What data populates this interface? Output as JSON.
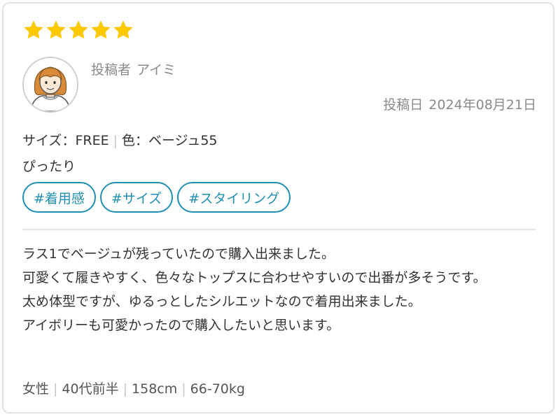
{
  "review": {
    "rating": 5,
    "rating_max": 5,
    "star_color": "#ffc700",
    "poster": {
      "label": "投稿者",
      "name": "アイミ"
    },
    "date": {
      "label": "投稿日",
      "value": "2024年08月21日"
    },
    "specs": {
      "size_label": "サイズ",
      "size_colon": "：",
      "size_value": "FREE",
      "separator": "|",
      "color_label": "色",
      "color_colon": "：",
      "color_value": "ベージュ55"
    },
    "fit": "ぴったり",
    "tags": [
      "#着用感",
      "#サイズ",
      "#スタイリング"
    ],
    "tag_color": "#1f8fb3",
    "body_lines": [
      "ラス1でベージュが残っていたので購入出来ました。",
      "可愛くて履きやすく、色々なトップスに合わせやすいので出番が多そうです。",
      "太め体型ですが、ゆるっとしたシルエットなので着用出来ました。",
      "アイボリーも可愛かったので購入したいと思います。"
    ],
    "profile": {
      "gender": "女性",
      "age": "40代前半",
      "height": "158cm",
      "weight": "66-70kg",
      "separator": "|"
    },
    "avatar_icon": "woman-avatar-icon"
  }
}
